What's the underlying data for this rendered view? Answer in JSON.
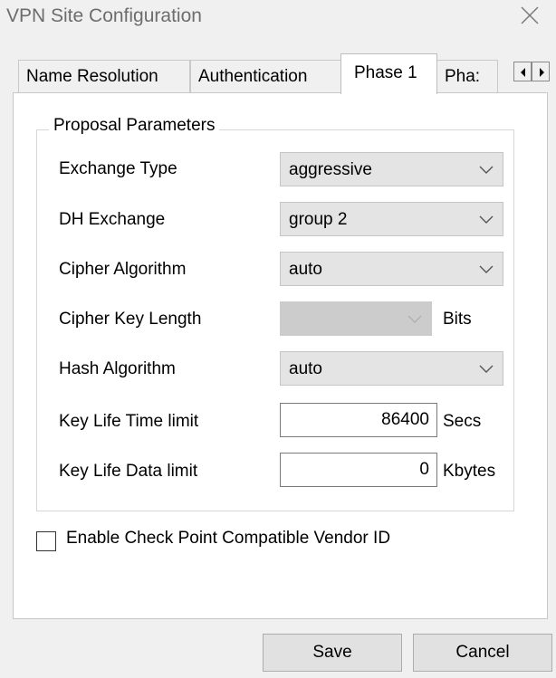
{
  "window": {
    "title": "VPN Site Configuration"
  },
  "tabs": [
    {
      "label": "Name Resolution",
      "active": false
    },
    {
      "label": "Authentication",
      "active": false
    },
    {
      "label": "Phase 1",
      "active": true
    },
    {
      "label": "Pha:",
      "active": false
    }
  ],
  "group": {
    "label": "Proposal Parameters",
    "fields": {
      "exchange_type": {
        "label": "Exchange Type",
        "value": "aggressive"
      },
      "dh_exchange": {
        "label": "DH Exchange",
        "value": "group 2"
      },
      "cipher_algorithm": {
        "label": "Cipher Algorithm",
        "value": "auto"
      },
      "cipher_key_length": {
        "label": "Cipher Key Length",
        "value": "",
        "unit": "Bits",
        "disabled": true
      },
      "hash_algorithm": {
        "label": "Hash Algorithm",
        "value": "auto"
      },
      "key_life_time": {
        "label": "Key Life Time limit",
        "value": "86400",
        "unit": "Secs"
      },
      "key_life_data": {
        "label": "Key Life Data limit",
        "value": "0",
        "unit": "Kbytes"
      }
    }
  },
  "vendor_checkbox": {
    "label": "Enable Check Point Compatible Vendor ID",
    "checked": false
  },
  "buttons": {
    "save": "Save",
    "cancel": "Cancel"
  }
}
